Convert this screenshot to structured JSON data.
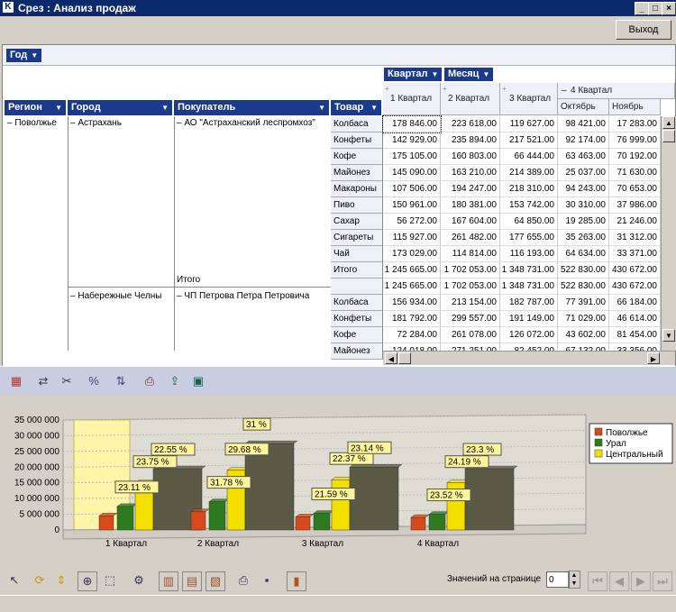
{
  "window": {
    "title": "Срез : Анализ продаж",
    "exit_label": "Выход"
  },
  "filter": {
    "year_label": "Год"
  },
  "col_fields": {
    "quarter": "Квартал",
    "month": "Месяц"
  },
  "row_fields": {
    "region": "Регион",
    "city": "Город",
    "buyer": "Покупатель",
    "product": "Товар"
  },
  "col_headers": {
    "q1": "1 Квартал",
    "q2": "2 Квартал",
    "q3": "3 Квартал",
    "q4": "4 Квартал",
    "oct": "Октябрь",
    "nov": "Ноябрь"
  },
  "rows": {
    "region": "Поволжье",
    "city1": "Астрахань",
    "buyer1": "АО \"Астраханский леспромхоз\"",
    "total": "Итого",
    "city2": "Набережные Челны",
    "buyer2": "ЧП Петрова Петра Петровича",
    "products1": [
      "Колбаса",
      "Конфеты",
      "Кофе",
      "Майонез",
      "Макароны",
      "Пиво",
      "Сахар",
      "Сигареты",
      "Чай",
      "Итого"
    ],
    "products2": [
      "Колбаса",
      "Конфеты",
      "Кофе",
      "Майонез"
    ]
  },
  "values": [
    [
      "178 846.00",
      "223 618.00",
      "119 627.00",
      "98 421.00",
      "17 283.00"
    ],
    [
      "142 929.00",
      "235 894.00",
      "217 521.00",
      "92 174.00",
      "76 999.00"
    ],
    [
      "175 105.00",
      "160 803.00",
      "66 444.00",
      "63 463.00",
      "70 192.00"
    ],
    [
      "145 090.00",
      "163 210.00",
      "214 389.00",
      "25 037.00",
      "71 630.00"
    ],
    [
      "107 506.00",
      "194 247.00",
      "218 310.00",
      "94 243.00",
      "70 653.00"
    ],
    [
      "150 961.00",
      "180 381.00",
      "153 742.00",
      "30 310.00",
      "37 986.00"
    ],
    [
      "56 272.00",
      "167 604.00",
      "64 850.00",
      "19 285.00",
      "21 246.00"
    ],
    [
      "115 927.00",
      "261 482.00",
      "177 655.00",
      "35 263.00",
      "31 312.00"
    ],
    [
      "173 029.00",
      "114 814.00",
      "116 193.00",
      "64 634.00",
      "33 371.00"
    ],
    [
      "1 245 665.00",
      "1 702 053.00",
      "1 348 731.00",
      "522 830.00",
      "430 672.00"
    ],
    [
      "1 245 665.00",
      "1 702 053.00",
      "1 348 731.00",
      "522 830.00",
      "430 672.00"
    ],
    [
      "156 934.00",
      "213 154.00",
      "182 787.00",
      "77 391.00",
      "66 184.00"
    ],
    [
      "181 792.00",
      "299 557.00",
      "191 149.00",
      "71 029.00",
      "46 614.00"
    ],
    [
      "72 284.00",
      "261 078.00",
      "126 072.00",
      "43 602.00",
      "81 454.00"
    ],
    [
      "124 018.00",
      "271 251.00",
      "82 452.00",
      "67 132.00",
      "33 356.00"
    ]
  ],
  "chart_data": {
    "type": "bar",
    "categories": [
      "1 Квартал",
      "2 Квартал",
      "3 Квартал",
      "4 Квартал"
    ],
    "yticks": [
      "35 000 000",
      "30 000 000",
      "25 000 000",
      "20 000 000",
      "15 000 000",
      "10 000 000",
      "5 000 000",
      "0"
    ],
    "ylim": [
      0,
      35000000
    ],
    "series": [
      {
        "name": "Поволжье",
        "color": "#d84a1a",
        "values": [
          4500000,
          5800000,
          4200000,
          4000000
        ]
      },
      {
        "name": "Урал",
        "color": "#2e7a1e",
        "values": [
          7500000,
          9000000,
          5300000,
          5000000
        ]
      },
      {
        "name": null,
        "color": "#f4e000",
        "values": [
          15000000,
          19000000,
          16000000,
          15000000
        ]
      },
      {
        "name": "Центральный",
        "color": "#5b5a45",
        "values": [
          19500000,
          27500000,
          20000000,
          19500000
        ]
      }
    ],
    "legend": [
      "Поволжье",
      "Урал",
      "Центральный"
    ],
    "labels": [
      [
        "23.11 %",
        "23.75 %",
        "22.55 %"
      ],
      [
        "31.78 %",
        "29.68 %",
        "31 %"
      ],
      [
        "21.59 %",
        "22.37 %",
        "23.14 %"
      ],
      [
        "23.52 %",
        "24.19 %",
        "23.3 %"
      ]
    ]
  },
  "pager": {
    "label": "Значений на странице",
    "value": "0"
  }
}
